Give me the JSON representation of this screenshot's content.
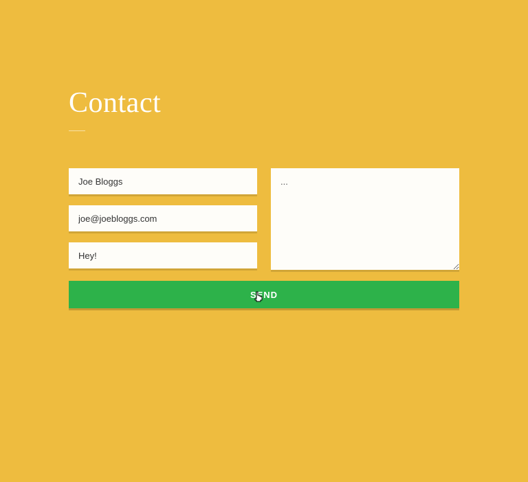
{
  "header": {
    "title": "Contact"
  },
  "form": {
    "name": {
      "value": "Joe Bloggs"
    },
    "email": {
      "value": "joe@joebloggs.com"
    },
    "subject": {
      "value": "Hey!"
    },
    "message": {
      "value": "..."
    },
    "send_label": "SEND"
  },
  "colors": {
    "background": "#eebc3f",
    "button": "#2db24a",
    "field_bg": "#fefdf9",
    "title": "#ffffff"
  }
}
